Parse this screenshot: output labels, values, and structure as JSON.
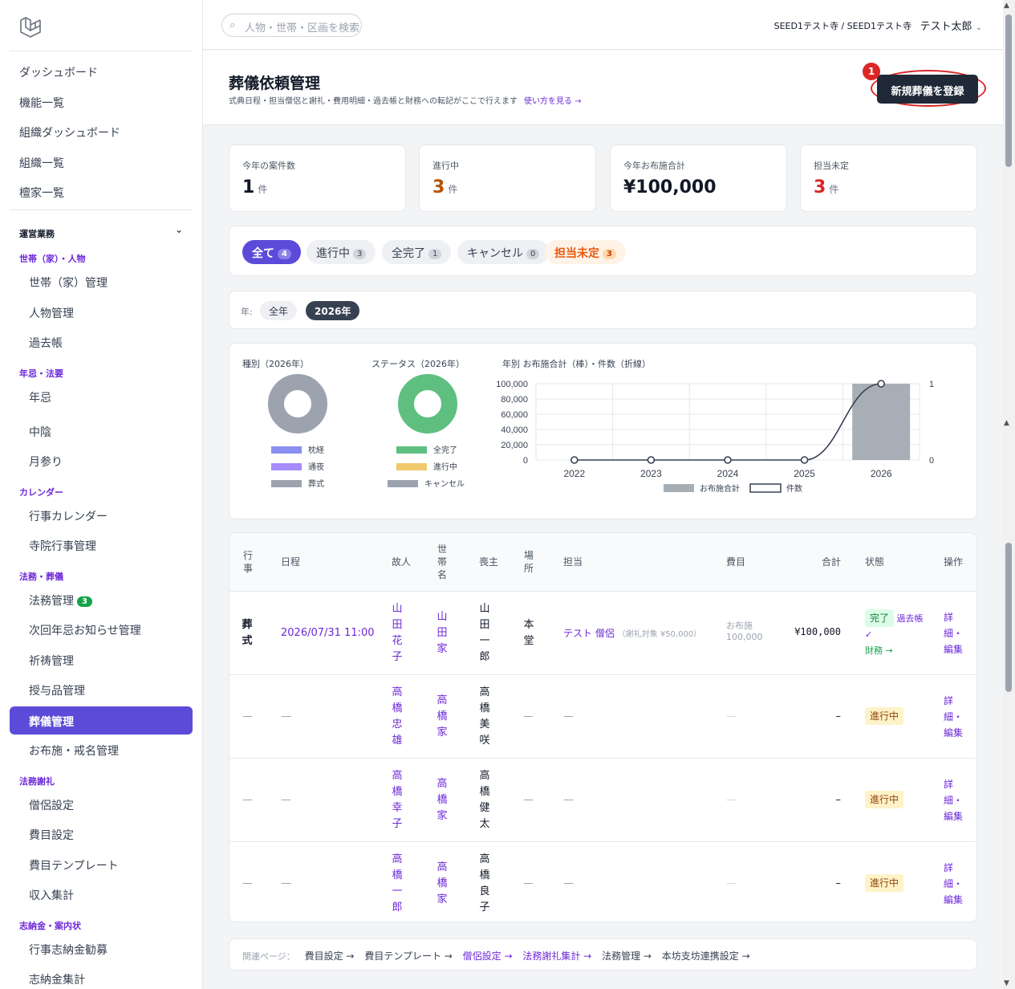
{
  "search": {
    "placeholder": "人物・世帯・区画を検索"
  },
  "org": "SEED1テスト寺 / SEED1テスト寺",
  "user": "テスト太郎",
  "sidebar": {
    "top": [
      "ダッシュボード",
      "機能一覧",
      "組織ダッシュボード",
      "組織一覧",
      "檀家一覧"
    ],
    "section": "運営業務",
    "g1": "世帯（家）・人物",
    "g1_items": [
      "世帯（家）管理",
      "人物管理",
      "過去帳"
    ],
    "g2": "年忌・法要",
    "g2_items": [
      "年忌",
      "中陰",
      "月参り"
    ],
    "g3": "カレンダー",
    "g3_items": [
      "行事カレンダー",
      "寺院行事管理"
    ],
    "g4": "法務・葬儀",
    "g4_items": [
      "法務管理",
      "次回年忌お知らせ管理",
      "祈祷管理",
      "授与品管理",
      "葬儀管理",
      "お布施・戒名管理"
    ],
    "g4_badge": "3",
    "g5": "法務謝礼",
    "g5_items": [
      "僧侶設定",
      "費目設定",
      "費目テンプレート",
      "収入集計"
    ],
    "g6": "志納金・案内状",
    "g6_items": [
      "行事志納金勧募",
      "志納金集計"
    ]
  },
  "header": {
    "title": "葬儀依頼管理",
    "subtitle": "式典日程・担当僧侶と謝礼・費用明細・過去帳と財務への転記がここで行えます",
    "help_link": "使い方を見る →",
    "new_button": "新規葬儀を登録",
    "marker": "1"
  },
  "stats": [
    {
      "label": "今年の案件数",
      "value": "1",
      "unit": "件",
      "color": "#111827"
    },
    {
      "label": "進行中",
      "value": "3",
      "unit": "件",
      "color": "#b45309"
    },
    {
      "label": "今年お布施合計",
      "value": "¥100,000",
      "unit": "",
      "color": "#111827"
    },
    {
      "label": "担当未定",
      "value": "3",
      "unit": "件",
      "color": "#dc2626"
    }
  ],
  "filters": [
    {
      "label": "全て",
      "count": "4"
    },
    {
      "label": "進行中",
      "count": "3"
    },
    {
      "label": "全完了",
      "count": "1"
    },
    {
      "label": "キャンセル",
      "count": "0"
    },
    {
      "label": "担当未定",
      "count": "3"
    }
  ],
  "year_filter": {
    "label": "年:",
    "options": [
      "全年",
      "2026年"
    ]
  },
  "charts": {
    "type_title": "種別（2026年）",
    "type_legend": [
      "枕経",
      "通夜",
      "葬式"
    ],
    "status_title": "ステータス（2026年）",
    "status_legend": [
      "全完了",
      "進行中",
      "キャンセル"
    ],
    "combo_title": "年別 お布施合計（棒）・件数（折線）",
    "combo_legend": [
      "お布施合計",
      "件数"
    ]
  },
  "chart_data": [
    {
      "type": "pie",
      "title": "種別（2026年）",
      "labels": [
        "枕経",
        "通夜",
        "葬式"
      ],
      "values": [
        0,
        0,
        1
      ],
      "colors": [
        "#8b8ff2",
        "#a78bfa",
        "#9ca3af"
      ]
    },
    {
      "type": "pie",
      "title": "ステータス（2026年）",
      "labels": [
        "全完了",
        "進行中",
        "キャンセル"
      ],
      "values": [
        1,
        0,
        0
      ],
      "colors": [
        "#5fbf80",
        "#f0c96b",
        "#9ca3af"
      ]
    },
    {
      "type": "bar",
      "title": "年別 お布施合計（棒）・件数（折線）",
      "categories": [
        "2022",
        "2023",
        "2024",
        "2025",
        "2026"
      ],
      "series": [
        {
          "name": "お布施合計",
          "kind": "bar",
          "values": [
            0,
            0,
            0,
            0,
            100000
          ]
        },
        {
          "name": "件数",
          "kind": "line",
          "values": [
            0,
            0,
            0,
            0,
            1
          ]
        }
      ],
      "ylim": [
        0,
        100000
      ],
      "y_ticks": [
        "100,000",
        "80,000",
        "60,000",
        "40,000",
        "20,000",
        "0"
      ],
      "y2lim": [
        0,
        1
      ],
      "y2_ticks": [
        "1",
        "0"
      ]
    }
  ],
  "table": {
    "headers": [
      "行事",
      "日程",
      "故人",
      "世帯名",
      "喪主",
      "場所",
      "担当",
      "費目",
      "合計",
      "状態",
      "操作"
    ],
    "rows": [
      {
        "event": "葬式",
        "date": "2026/07/31 11:00",
        "deceased": "山田花子",
        "household": "山田家",
        "chief": "山田一郎",
        "place": "本堂",
        "staff": "テスト 僧侶",
        "staff_note": "（謝礼対象 ¥50,000）",
        "item": "お布施",
        "item_amt": "100,000",
        "total": "¥100,000",
        "status": "完了",
        "kako": "過去帳✓",
        "zaimu": "財務 →",
        "op": "詳細・編集"
      },
      {
        "event": "—",
        "date": "—",
        "deceased": "高橋忠雄",
        "household": "高橋家",
        "chief": "高橋美咲",
        "place": "—",
        "staff": "—",
        "item": "—",
        "total": "–",
        "status": "進行中",
        "op": "詳細・編集"
      },
      {
        "event": "—",
        "date": "—",
        "deceased": "高橋幸子",
        "household": "高橋家",
        "chief": "高橋健太",
        "place": "—",
        "staff": "—",
        "item": "—",
        "total": "–",
        "status": "進行中",
        "op": "詳細・編集"
      },
      {
        "event": "—",
        "date": "—",
        "deceased": "高橋一郎",
        "household": "高橋家",
        "chief": "高橋良子",
        "place": "—",
        "staff": "—",
        "item": "—",
        "total": "–",
        "status": "進行中",
        "op": "詳細・編集"
      }
    ]
  },
  "footer": {
    "label": "関連ページ：",
    "links": [
      "費目設定 →",
      "費目テンプレート →",
      "僧侶設定 →",
      "法務謝礼集計 →",
      "法務管理 →",
      "本坊支坊連携設定 →"
    ]
  }
}
